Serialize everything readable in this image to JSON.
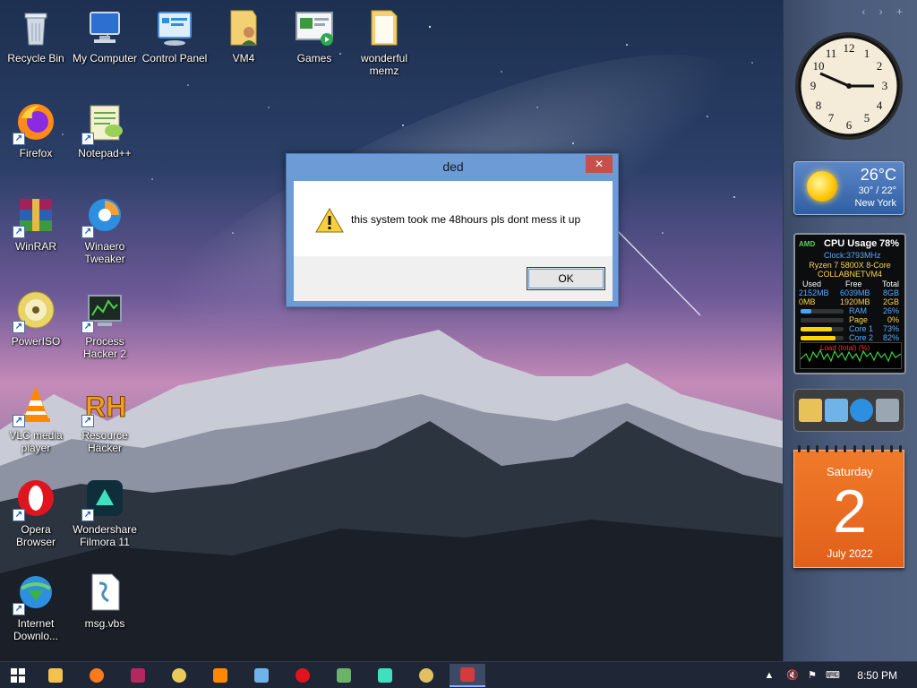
{
  "desktop": {
    "icons": [
      {
        "label": "Recycle Bin",
        "icon": "recycle-bin-icon"
      },
      {
        "label": "My Computer",
        "icon": "computer-icon"
      },
      {
        "label": "Control Panel",
        "icon": "control-panel-icon"
      },
      {
        "label": "VM4",
        "icon": "user-folder-icon"
      },
      {
        "label": "Games",
        "icon": "games-icon"
      },
      {
        "label": "wonderful memz",
        "icon": "folder-icon"
      },
      {
        "label": "Firefox",
        "icon": "firefox-icon"
      },
      {
        "label": "Notepad++",
        "icon": "notepad-plus-plus-icon"
      },
      {
        "label": "WinRAR",
        "icon": "winrar-icon"
      },
      {
        "label": "Winaero Tweaker",
        "icon": "winaero-tweaker-icon"
      },
      {
        "label": "PowerISO",
        "icon": "poweriso-icon"
      },
      {
        "label": "Process Hacker 2",
        "icon": "process-hacker-icon"
      },
      {
        "label": "VLC media player",
        "icon": "vlc-icon"
      },
      {
        "label": "Resource Hacker",
        "icon": "resource-hacker-icon"
      },
      {
        "label": "Opera Browser",
        "icon": "opera-icon"
      },
      {
        "label": "Wondershare Filmora 11",
        "icon": "filmora-icon"
      },
      {
        "label": "Internet Downlo...",
        "icon": "internet-download-manager-icon"
      },
      {
        "label": "msg.vbs",
        "icon": "script-file-icon"
      }
    ]
  },
  "dialog": {
    "title": "ded",
    "close": "✕",
    "message": "this system took me 48hours pls dont mess it up",
    "ok_label": "OK"
  },
  "gadgets": {
    "weather": {
      "temp": "26°C",
      "range": "30° / 22°",
      "city": "New York"
    },
    "cpu": {
      "title": "CPU Usage",
      "percent": "78%",
      "brand": "AMD",
      "clock": "Clock:3793MHz",
      "model": "Ryzen 7 5800X 8-Core",
      "host": "COLLABNETVM4",
      "headers": {
        "used": "Used",
        "free": "Free",
        "total": "Total"
      },
      "mem_rows": [
        {
          "used": "2152MB",
          "free": "6039MB",
          "total": "8GB"
        },
        {
          "used": "0MB",
          "free": "1920MB",
          "total": "2GB"
        }
      ],
      "bars": [
        {
          "label": "RAM",
          "value": "26%",
          "fraction": 0.26,
          "color": "#4aa3ff"
        },
        {
          "label": "Page",
          "value": "0%",
          "fraction": 0.0,
          "color": "#4aa3ff"
        },
        {
          "label": "Core 1",
          "value": "73%",
          "fraction": 0.73,
          "color": "#ffd400"
        },
        {
          "label": "Core 2",
          "value": "82%",
          "fraction": 0.82,
          "color": "#ffd400"
        }
      ],
      "graph_label": "Load (total) (%)"
    },
    "calendar": {
      "weekday": "Saturday",
      "day": "2",
      "month_year": "July 2022"
    },
    "sidebar_controls": "‹ › +"
  },
  "taskbar": {
    "items": [
      {
        "name": "start-button",
        "color": "#ffffff"
      },
      {
        "name": "file-explorer",
        "color": "#f2c14e"
      },
      {
        "name": "firefox",
        "color": "#ff7a1a"
      },
      {
        "name": "winrar",
        "color": "#b5285f"
      },
      {
        "name": "poweriso",
        "color": "#e8c95a"
      },
      {
        "name": "vlc",
        "color": "#ff8800"
      },
      {
        "name": "control-panel",
        "color": "#6fb3e8"
      },
      {
        "name": "opera",
        "color": "#e0141e"
      },
      {
        "name": "process-hacker",
        "color": "#6bb36b"
      },
      {
        "name": "filmora",
        "color": "#3ee0c0"
      },
      {
        "name": "poweriso-2",
        "color": "#e0c060"
      },
      {
        "name": "script-host",
        "color": "#d23c3c"
      }
    ],
    "time": "8:50 PM"
  }
}
